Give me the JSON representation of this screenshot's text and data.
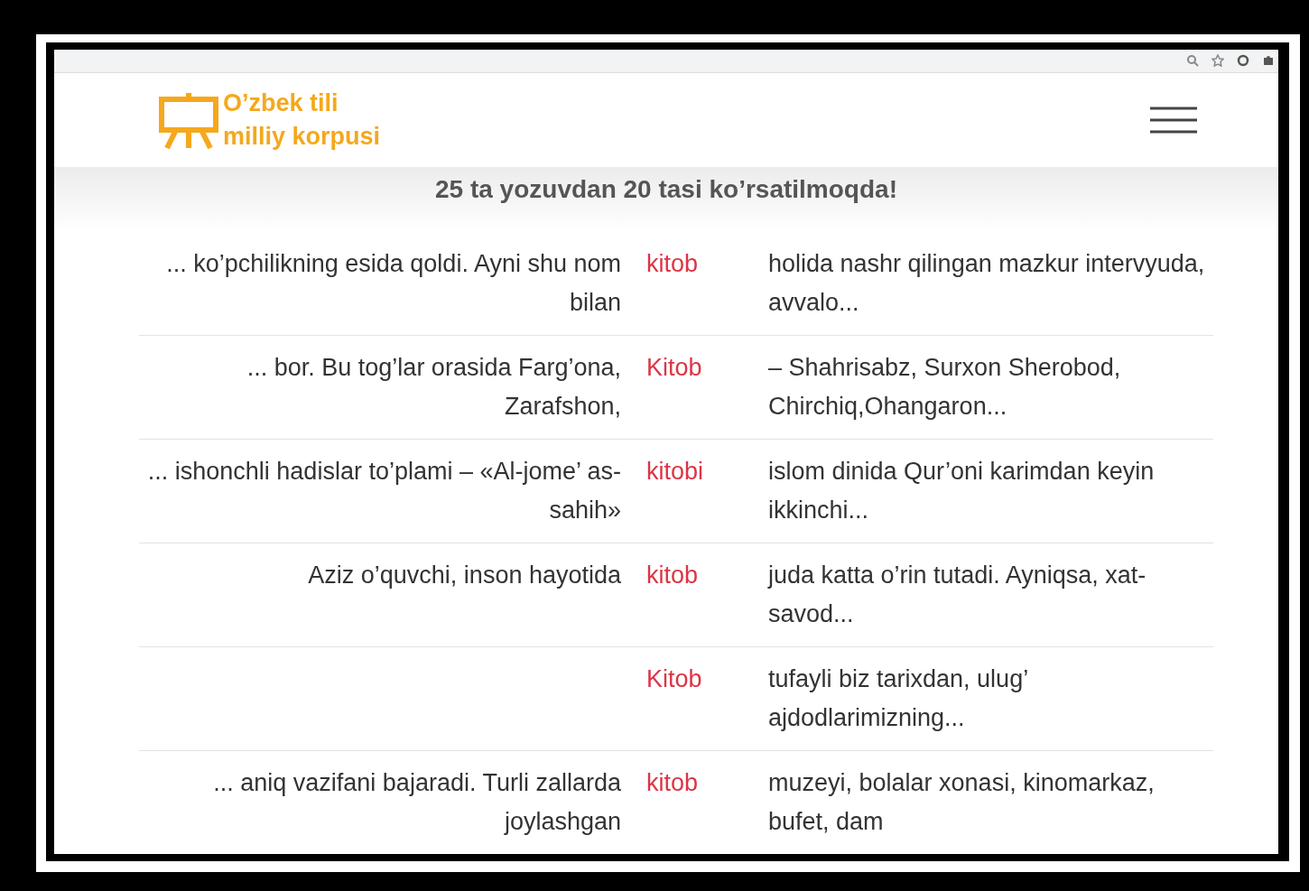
{
  "header": {
    "logo_lines": [
      "O’zbek tili",
      "milliy korpusi"
    ]
  },
  "results": {
    "heading": "25 ta yozuvdan 20 tasi ko’rsatilmoqda!",
    "rows": [
      {
        "left": "... ko’pchilikning esida qoldi. Ayni shu nom bilan",
        "keyword": "kitob",
        "right": "holida nashr qilingan mazkur intervyuda, avvalo..."
      },
      {
        "left": "... bor. Bu tog’lar orasida Farg’ona, Zarafshon,",
        "keyword": "Kitob",
        "right": "– Shahrisabz, Surxon Sherobod, Chirchiq,Ohangaron..."
      },
      {
        "left": "... ishonchli hadislar to’plami – «Al-jome’ as-sahih»",
        "keyword": "kitobi",
        "right": "islom dinida Qur’oni karimdan keyin ikkinchi..."
      },
      {
        "left": "Aziz o’quvchi, inson hayotida",
        "keyword": "kitob",
        "right": "juda katta o’rin tutadi. Ayniqsa, xat-savod..."
      },
      {
        "keyword": "Kitob",
        "right": "tufayli biz tarixdan, ulug’ ajdodlarimizning..."
      },
      {
        "left": "... aniq vazifani bajaradi. Turli zallarda joylashgan",
        "keyword": "kitob",
        "right": "muzeyi, bolalar xonasi, kinomarkaz, bufet, dam"
      }
    ]
  }
}
